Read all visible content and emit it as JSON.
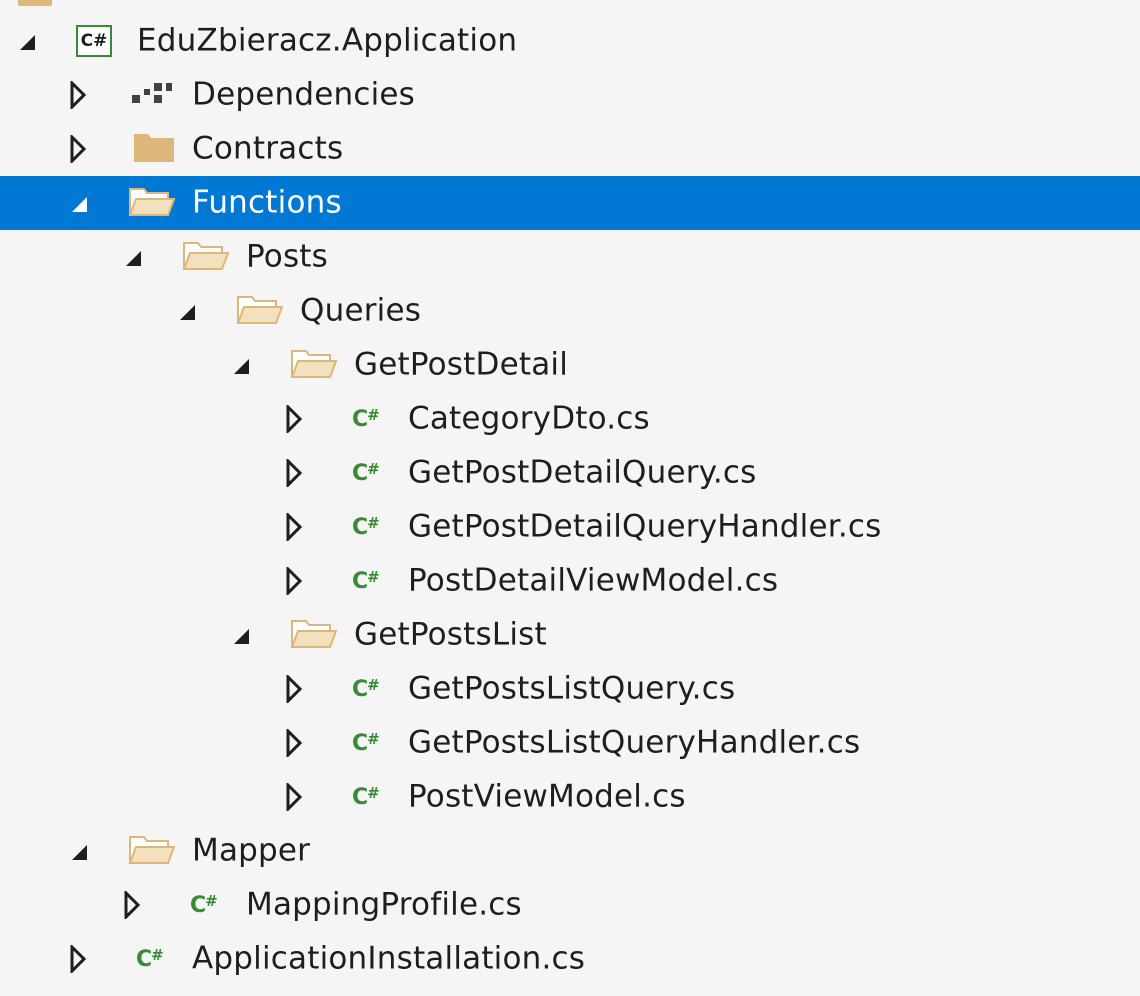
{
  "solution_explorer": {
    "project": {
      "label": "EduZbieracz.Application",
      "icon": "csharp-project-icon",
      "icon_text": "C#"
    },
    "items": [
      {
        "label": "Dependencies",
        "icon": "dependencies-icon",
        "expanded": false
      },
      {
        "label": "Contracts",
        "icon": "folder-closed-icon",
        "expanded": false
      },
      {
        "label": "Functions",
        "icon": "folder-open-icon",
        "expanded": true,
        "selected": true
      },
      {
        "label": "Posts",
        "icon": "folder-open-icon",
        "expanded": true
      },
      {
        "label": "Queries",
        "icon": "folder-open-icon",
        "expanded": true
      },
      {
        "label": "GetPostDetail",
        "icon": "folder-open-icon",
        "expanded": true
      },
      {
        "label": "CategoryDto.cs",
        "icon": "csharp-file-icon",
        "expanded": false
      },
      {
        "label": "GetPostDetailQuery.cs",
        "icon": "csharp-file-icon",
        "expanded": false
      },
      {
        "label": "GetPostDetailQueryHandler.cs",
        "icon": "csharp-file-icon",
        "expanded": false
      },
      {
        "label": "PostDetailViewModel.cs",
        "icon": "csharp-file-icon",
        "expanded": false
      },
      {
        "label": "GetPostsList",
        "icon": "folder-open-icon",
        "expanded": true
      },
      {
        "label": "GetPostsListQuery.cs",
        "icon": "csharp-file-icon",
        "expanded": false
      },
      {
        "label": "GetPostsListQueryHandler.cs",
        "icon": "csharp-file-icon",
        "expanded": false
      },
      {
        "label": "PostViewModel.cs",
        "icon": "csharp-file-icon",
        "expanded": false
      },
      {
        "label": "Mapper",
        "icon": "folder-open-icon",
        "expanded": true
      },
      {
        "label": "MappingProfile.cs",
        "icon": "csharp-file-icon",
        "expanded": false
      },
      {
        "label": "ApplicationInstallation.cs",
        "icon": "csharp-file-icon",
        "expanded": false
      }
    ],
    "cs_glyph": "C#"
  },
  "colors": {
    "background": "#f5f5f5",
    "selection": "#0078d4",
    "folder": "#dcb67a",
    "csharp_green": "#388a34"
  }
}
